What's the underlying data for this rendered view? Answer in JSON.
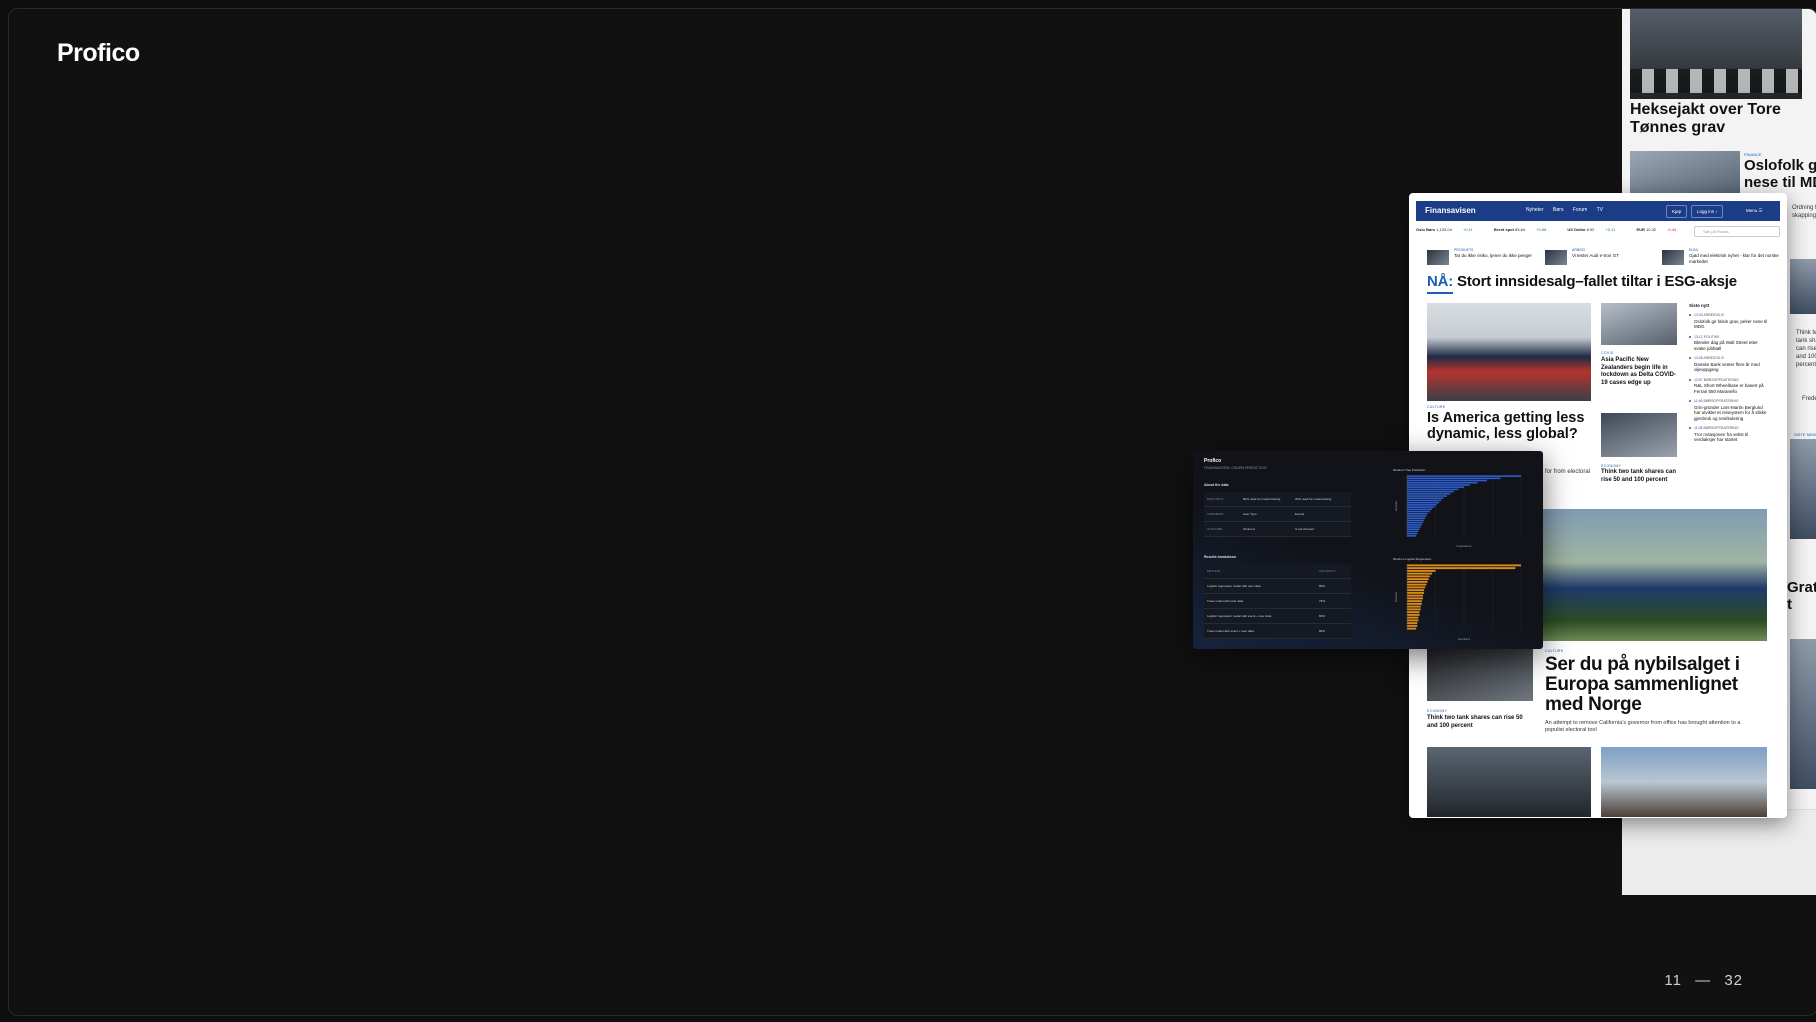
{
  "logo": "Profico",
  "pager": {
    "current": "11",
    "separator": "—",
    "total": "32"
  },
  "background_page": {
    "headline_1": "Heksejakt over Tore Tønnes grav",
    "kicker_2": "FINANCE",
    "headline_2": "Oslofolk gi nese til MD",
    "snippet": "Ordning fra F... skapping",
    "right_snippet": "Think two tank shares can rise 50 and 100 percent",
    "byline": "Frederik A",
    "tag": "SISTE NEWMAN",
    "gratis": "Gratis t"
  },
  "article": {
    "brand": "Finansavisen",
    "nav": [
      "Nyheter",
      "Børs",
      "Forum",
      "TV"
    ],
    "buttons": {
      "kjop": "Kjøp",
      "login": "Logg inn",
      "menu": "Menu"
    },
    "ticker": [
      {
        "label": "Oslo Børs",
        "value": "1,133.04",
        "change": "+0,11"
      },
      {
        "label": "Brent spot",
        "value": "83.64",
        "change": "+0,68"
      },
      {
        "label": "US Dollar",
        "value": "8.92",
        "change": "+0,11"
      },
      {
        "label": "EUR",
        "value": "10.42",
        "change": "-0,44"
      }
    ],
    "search_placeholder": "Søk på Finans",
    "teasers": [
      {
        "kicker": "PRODUKTS",
        "text": "Tar du ikke risiko, tjener du ikke penger"
      },
      {
        "kicker": "ARBEID",
        "text": "Vi tester Audi e-tron GT"
      },
      {
        "kicker": "ELBIL",
        "text": "Gjød med elektrisk nyhet - klar for det norske markedet"
      }
    ],
    "headline_prefix": "NÅ:",
    "headline": "Stort innsidesalg–fallet tiltar i ESG-aksje",
    "stories": {
      "america_kicker": "CULTURE",
      "america": "Is America getting less dynamic, less global?",
      "asia_kicker": "COVID",
      "asia": "Asia Pacific New Zealanders begin life in lockdown as Delta COVID-19 cases edge up",
      "tank_kicker": "ECONOMY",
      "tank": "Think two tank shares can rise 50 and 100 percent",
      "electoral": "for from electoral",
      "nybil_kicker": "CULTURE",
      "nybil": "Ser du på nybilsalget i Europa sammenlignet med Norge",
      "nybil_sub": "An attempt to remove California's governor from office has brought attention to a populist electoral tool",
      "tank2_kicker": "ECONOMY",
      "tank2": "Think two tank shares can rise 50 and 100 percent"
    },
    "latest_title": "Siste nytt",
    "latest": [
      {
        "time": "13:33",
        "cat": "ARBEIDSLIV",
        "text": "Oslofolk gir falsin grav, peker nese til MDG"
      },
      {
        "time": "13:12",
        "cat": "POLITIKK",
        "text": "Blender dag på Wall Street etter svake jobbtall"
      },
      {
        "time": "13:08",
        "cat": "ARBEIDSLIV",
        "text": "Danske Bank venter flere år med oljeoppgang"
      },
      {
        "time": "12:57",
        "cat": "BØRSOPPDATERING",
        "text": "R&L Short Wheelbase er basert på Ferrari 550 Maranello"
      },
      {
        "time": "11:46",
        "cat": "BØRSOPPDATERING",
        "text": "Grin-gründer Lars-Martin Berglund har utviklet et reiseystem for å slikke gjenbruk og resirkulering"
      },
      {
        "time": "11:08",
        "cat": "BØRSOPPDATERING",
        "text": "Tror notasjonen fra vekst til verdiaksjer har startet"
      }
    ]
  },
  "dashboard": {
    "logo": "Profico",
    "subtitle": "FINANSAVISEN: CHURN PREDICTION",
    "about_title": "About the data",
    "about_rows": [
      [
        "DATA SPLIT",
        "80% used for model training",
        "20% used for model testing"
      ],
      [
        "VARIABLES",
        "User Type",
        "Events"
      ],
      [
        "OUTCOME",
        "Churned",
        "Is not churned"
      ]
    ],
    "results_title": "Results breakdown",
    "results_header": [
      "METHOD",
      "ACCURACY"
    ],
    "results_rows": [
      [
        "Logistic regression model with user data",
        "86%"
      ],
      [
        "Trees model with user data",
        "73%"
      ],
      [
        "Logistic regression model with event + user data",
        "84%"
      ],
      [
        "Trees model with event + user data",
        "86%"
      ]
    ],
    "chart1_title": "Random Tree Prediction",
    "chart1_xlabel": "Importance",
    "chart1_ylabel": "Feature",
    "chart2_title": "Random Logistic Regression",
    "chart2_xlabel": "Accuracy",
    "chart2_ylabel": "Feature",
    "colors": {
      "chart1": "#2f5fd0",
      "chart2": "#d98a18"
    }
  },
  "chart_data": [
    {
      "type": "bar",
      "title": "Random Tree Prediction",
      "xlabel": "Importance",
      "ylabel": "Feature",
      "values": [
        1.0,
        0.82,
        0.7,
        0.62,
        0.55,
        0.5,
        0.45,
        0.41,
        0.38,
        0.35,
        0.32,
        0.3,
        0.28,
        0.26,
        0.24,
        0.22,
        0.2,
        0.18,
        0.17,
        0.16,
        0.15,
        0.14,
        0.13,
        0.12,
        0.11,
        0.1,
        0.09,
        0.08
      ]
    },
    {
      "type": "bar",
      "title": "Random Logistic Regression",
      "xlabel": "Accuracy",
      "ylabel": "Feature",
      "values": [
        1.0,
        0.95,
        0.25,
        0.22,
        0.2,
        0.19,
        0.18,
        0.17,
        0.16,
        0.15,
        0.15,
        0.14,
        0.14,
        0.13,
        0.13,
        0.12,
        0.12,
        0.11,
        0.11,
        0.1,
        0.1,
        0.09,
        0.09,
        0.08
      ]
    }
  ]
}
